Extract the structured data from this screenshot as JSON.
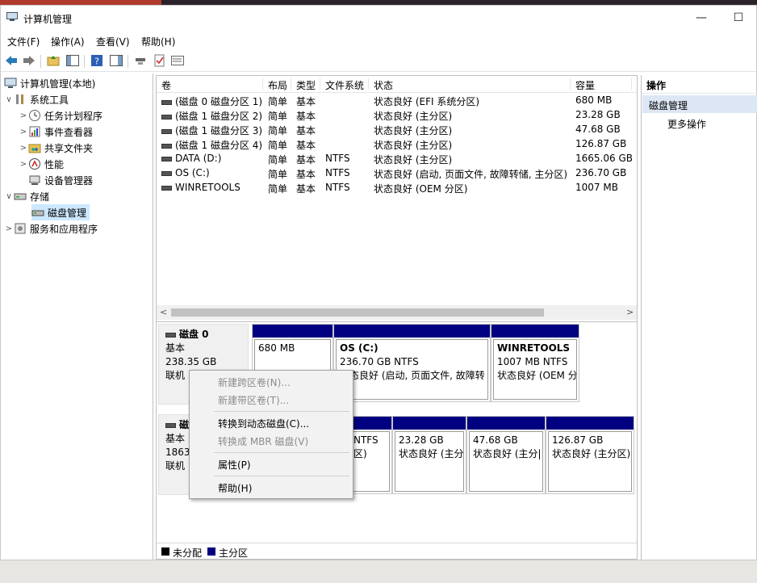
{
  "window": {
    "title": "计算机管理",
    "minimize": "—",
    "maximize": "☐",
    "close": "✕"
  },
  "menu": [
    "文件(F)",
    "操作(A)",
    "查看(V)",
    "帮助(H)"
  ],
  "tree": {
    "root": "计算机管理(本地)",
    "system_tools": "系统工具",
    "task_scheduler": "任务计划程序",
    "event_viewer": "事件查看器",
    "shared_folders": "共享文件夹",
    "performance": "性能",
    "device_manager": "设备管理器",
    "storage": "存储",
    "disk_management": "磁盘管理",
    "services_apps": "服务和应用程序"
  },
  "table": {
    "columns": [
      "卷",
      "布局",
      "类型",
      "文件系统",
      "状态",
      "容量"
    ],
    "rows": [
      {
        "vol": "(磁盘 0 磁盘分区 1)",
        "layout": "简单",
        "type": "基本",
        "fs": "",
        "status": "状态良好 (EFI 系统分区)",
        "cap": "680 MB"
      },
      {
        "vol": "(磁盘 1 磁盘分区 2)",
        "layout": "简单",
        "type": "基本",
        "fs": "",
        "status": "状态良好 (主分区)",
        "cap": "23.28 GB"
      },
      {
        "vol": "(磁盘 1 磁盘分区 3)",
        "layout": "简单",
        "type": "基本",
        "fs": "",
        "status": "状态良好 (主分区)",
        "cap": "47.68 GB"
      },
      {
        "vol": "(磁盘 1 磁盘分区 4)",
        "layout": "简单",
        "type": "基本",
        "fs": "",
        "status": "状态良好 (主分区)",
        "cap": "126.87 GB"
      },
      {
        "vol": "DATA (D:)",
        "layout": "简单",
        "type": "基本",
        "fs": "NTFS",
        "status": "状态良好 (主分区)",
        "cap": "1665.06 GB"
      },
      {
        "vol": "OS (C:)",
        "layout": "简单",
        "type": "基本",
        "fs": "NTFS",
        "status": "状态良好 (启动, 页面文件, 故障转储, 主分区)",
        "cap": "236.70 GB"
      },
      {
        "vol": "WINRETOOLS",
        "layout": "简单",
        "type": "基本",
        "fs": "NTFS",
        "status": "状态良好 (OEM 分区)",
        "cap": "1007 MB"
      }
    ]
  },
  "disk0": {
    "name": "磁盘 0",
    "kind": "基本",
    "size": "238.35 GB",
    "state": "联机",
    "p1": {
      "l1": "680 MB"
    },
    "p2": {
      "l1": "OS  (C:)",
      "l2": "236.70 GB NTFS",
      "l3": "状态良好 (启动, 页面文件, 故障转"
    },
    "p3": {
      "l1": "WINRETOOLS",
      "l2": "1007 MB NTFS",
      "l3": "状态良好 (OEM 分"
    }
  },
  "disk1": {
    "name": "磁",
    "kind": "基本",
    "size": "1863.",
    "state": "联机",
    "p1": {
      "l1": "NTFS",
      "l2": "区)"
    },
    "p2": {
      "l1": "23.28 GB",
      "l2": "状态良好 (主分"
    },
    "p3": {
      "l1": "47.68 GB",
      "l2": "状态良好 (主分|"
    },
    "p4": {
      "l1": "126.87 GB",
      "l2": "状态良好 (主分区)"
    }
  },
  "legend": {
    "unallocated": "未分配",
    "primary": "主分区"
  },
  "actions": {
    "header": "操作",
    "section": "磁盘管理",
    "more": "更多操作"
  },
  "context_menu": {
    "spanned": "新建跨区卷(N)...",
    "striped": "新建带区卷(T)...",
    "convert_dynamic": "转换到动态磁盘(C)...",
    "convert_mbr": "转换成 MBR 磁盘(V)",
    "properties": "属性(P)",
    "help": "帮助(H)"
  },
  "colors": {
    "primary_partition": "#000080",
    "unallocated": "#000000",
    "selection": "#cce8ff",
    "actions_selected": "#dce6f4"
  }
}
